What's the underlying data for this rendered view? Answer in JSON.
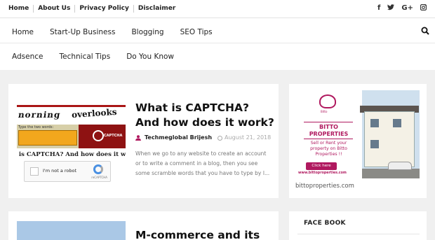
{
  "topbar": {
    "links": [
      "Home",
      "About Us",
      "Privacy Policy",
      "Disclaimer"
    ],
    "social": [
      {
        "icon": "facebook-icon",
        "glyph": "f"
      },
      {
        "icon": "twitter-icon",
        "glyph": "🐦"
      },
      {
        "icon": "google-plus-icon",
        "glyph": "G+"
      },
      {
        "icon": "instagram-icon",
        "glyph": "◘"
      }
    ]
  },
  "nav": {
    "items": [
      "Home",
      "Start-Up Business",
      "Blogging",
      "SEO Tips"
    ],
    "sub_items": [
      "Adsence",
      "Technical Tips",
      "Do You Know"
    ]
  },
  "posts": [
    {
      "title": "What is CAPTCHA? And how does it work?",
      "author": "Techmeglobal Brijesh",
      "date": "August 21, 2018",
      "excerpt": "When we go to any website to create an account or to write a comment in a blog, then you see some scramble words that you have to type by l...",
      "thumb": {
        "word1": "norning",
        "word2": "overlooks",
        "form_label": "Type the two words:",
        "logo_text": "CAPTCHA",
        "caption": "t is CAPTCHA? And how does it wo",
        "recaptcha_label": "I'm not a robot",
        "recaptcha_brand": "reCAPTCHA"
      }
    },
    {
      "title": "M-commerce and its"
    }
  ],
  "sidebar": {
    "ad": {
      "tagline": "Bitto",
      "brand": "BITTO PROPERTIES",
      "copy": "Sell or Rent your property on Bitto Properties !!",
      "button": "Click here",
      "url": "www.bittoproperties.com",
      "caption": "bittoproperties.com"
    },
    "facebook_title": "FACE BOOK"
  },
  "colors": {
    "page_bg": "#f0f0f0",
    "brand": "#b0195f",
    "captcha_red": "#aa1616"
  }
}
